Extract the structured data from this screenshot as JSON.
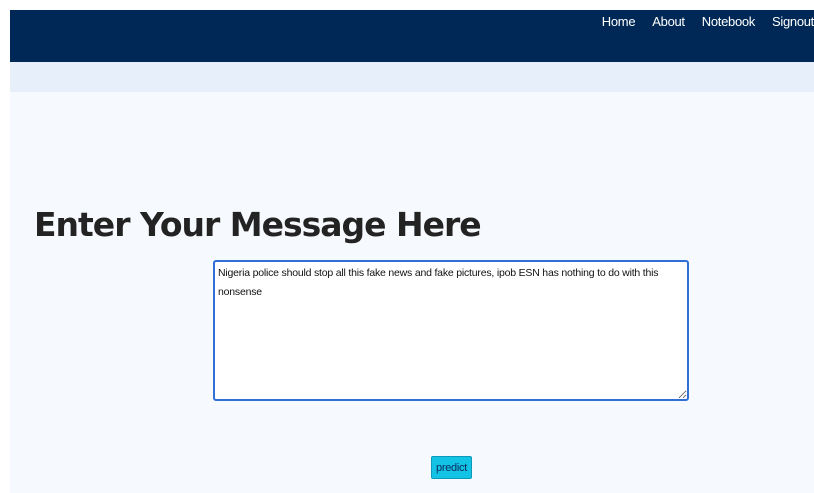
{
  "nav": {
    "links": [
      "Home",
      "About",
      "Notebook",
      "Signout"
    ]
  },
  "main": {
    "heading": "Enter Your Message Here",
    "message": "Nigeria police should stop all this fake news and fake pictures, ipob ESN has nothing to do with this nonsense",
    "predict_label": "predict"
  },
  "colors": {
    "navbar": "#002857",
    "subbar": "#e7effb",
    "page_background": "#f6f9fe",
    "textarea_border": "#2f6fd6",
    "button": "#13c3e6"
  }
}
